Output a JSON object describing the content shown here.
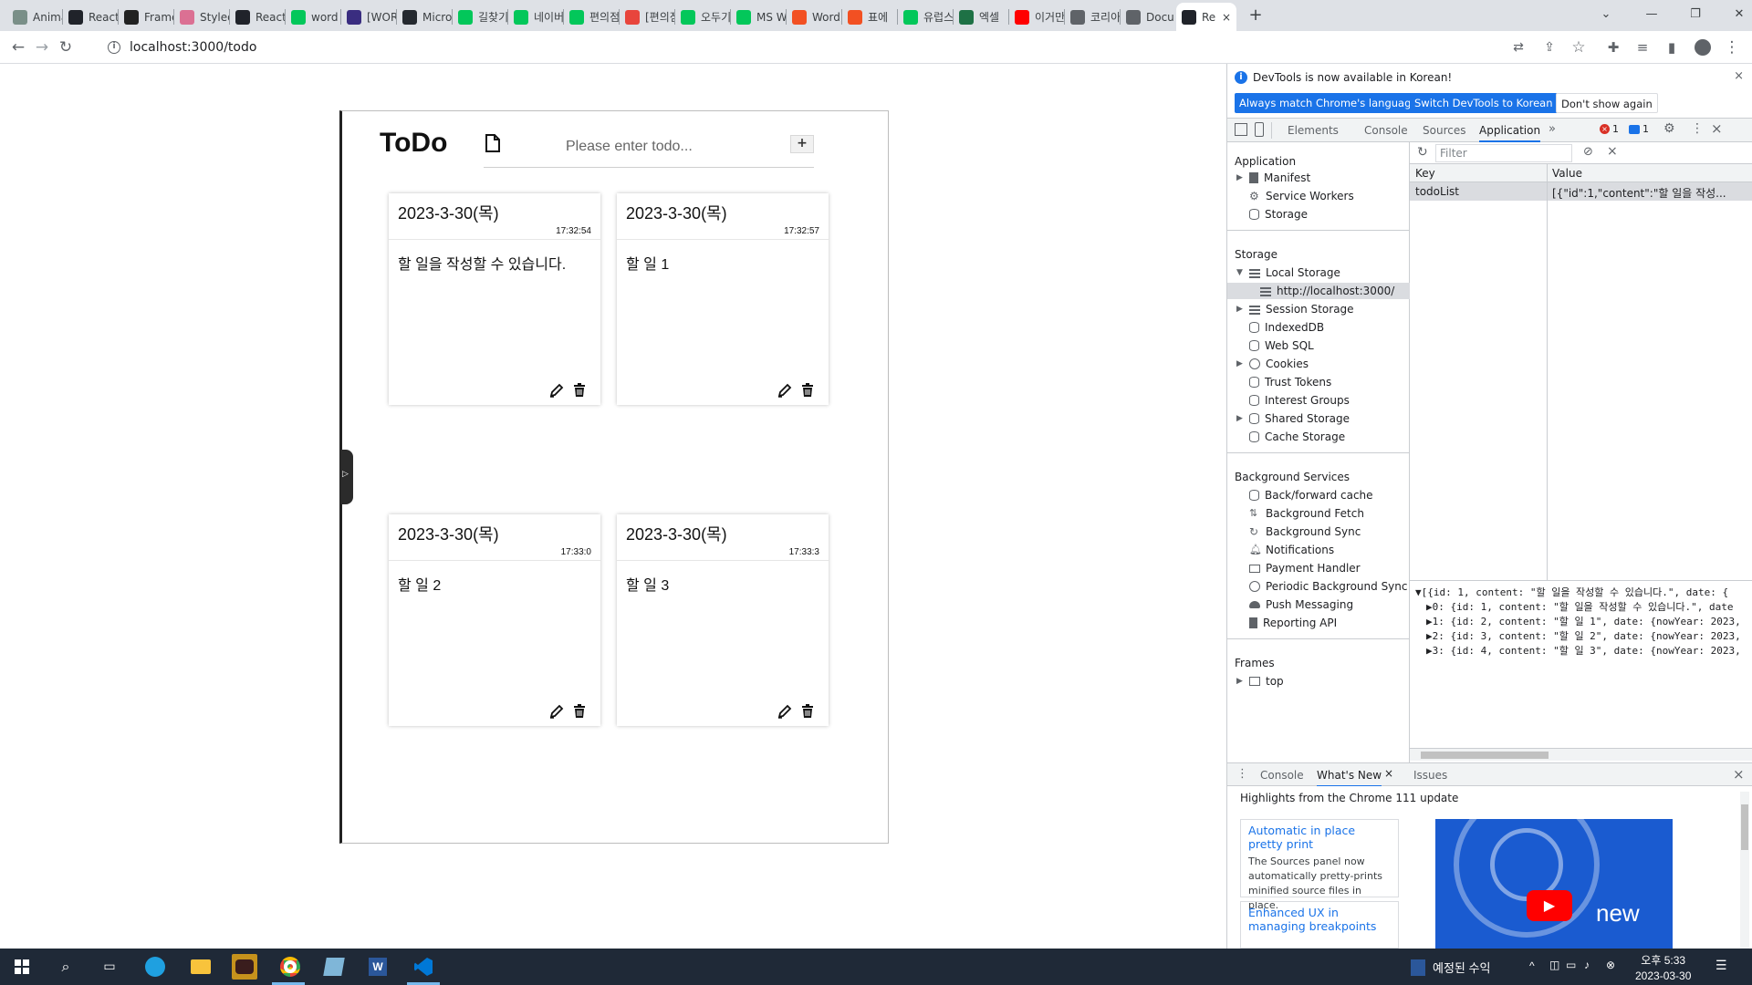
{
  "browser": {
    "tabs": [
      {
        "title": "Anima",
        "icon": "anima-favicon",
        "color": "#7a8f88"
      },
      {
        "title": "React",
        "icon": "react-favicon",
        "color": "#20232a"
      },
      {
        "title": "Frame",
        "icon": "framer-favicon",
        "color": "#222222"
      },
      {
        "title": "Styled",
        "icon": "styled-favicon",
        "color": "#db7093"
      },
      {
        "title": "React",
        "icon": "react-favicon",
        "color": "#20232a"
      },
      {
        "title": "word",
        "icon": "n-favicon",
        "color": "#03c75a"
      },
      {
        "title": "[WOR",
        "icon": "ag-favicon",
        "color": "#3a2d80"
      },
      {
        "title": "Micro",
        "icon": "github-favicon",
        "color": "#24292f"
      },
      {
        "title": "길찾기",
        "icon": "map-favicon",
        "color": "#03c75a"
      },
      {
        "title": "네이버",
        "icon": "map-favicon",
        "color": "#03c75a"
      },
      {
        "title": "편의점",
        "icon": "blog-favicon",
        "color": "#03c75a"
      },
      {
        "title": "[편의점",
        "icon": "t-favicon",
        "color": "#e8453c"
      },
      {
        "title": "오두기",
        "icon": "blog-favicon",
        "color": "#03c75a"
      },
      {
        "title": "MS W",
        "icon": "blog-favicon",
        "color": "#03c75a"
      },
      {
        "title": "Word",
        "icon": "ms-favicon",
        "color": "#f25022"
      },
      {
        "title": "표에 ",
        "icon": "ms-favicon",
        "color": "#f25022"
      },
      {
        "title": "유럽스",
        "icon": "blog-favicon",
        "color": "#03c75a"
      },
      {
        "title": "엑셀 ",
        "icon": "sheet-favicon",
        "color": "#1e7145"
      },
      {
        "title": "이거만",
        "icon": "youtube-favicon",
        "color": "#ff0000"
      },
      {
        "title": "코리아",
        "icon": "globe-favicon",
        "color": "#5f6368"
      },
      {
        "title": "Docu",
        "icon": "globe-favicon",
        "color": "#5f6368"
      },
      {
        "title": "Re",
        "icon": "react-favicon",
        "color": "#20232a",
        "active": true
      }
    ],
    "new_tab_label": "+",
    "url": "localhost:3000/todo"
  },
  "todo_app": {
    "title": "ToDo",
    "input_placeholder": "Please enter todo...",
    "add_button_label": "+",
    "cards": [
      {
        "date": "2023-3-30(목)",
        "time": "17:32:54",
        "content": "할 일을 작성할 수 있습니다."
      },
      {
        "date": "2023-3-30(목)",
        "time": "17:32:57",
        "content": "할 일 1"
      },
      {
        "date": "2023-3-30(목)",
        "time": "17:33:0",
        "content": "할 일 2"
      },
      {
        "date": "2023-3-30(목)",
        "time": "17:33:3",
        "content": "할 일 3"
      }
    ]
  },
  "devtools": {
    "info_message": "DevTools is now available in Korean!",
    "info_buttons": [
      "Always match Chrome's language",
      "Switch DevTools to Korean",
      "Don't show again"
    ],
    "panel_tabs": [
      "Elements",
      "Console",
      "Sources",
      "Application"
    ],
    "active_panel": "Application",
    "error_count": "1",
    "message_count": "1",
    "sidebar": {
      "application_header": "Application",
      "application_items": [
        "Manifest",
        "Service Workers",
        "Storage"
      ],
      "storage_header": "Storage",
      "storage_items": [
        "Local Storage",
        "http://localhost:3000/",
        "Session Storage",
        "IndexedDB",
        "Web SQL",
        "Cookies",
        "Trust Tokens",
        "Interest Groups",
        "Shared Storage",
        "Cache Storage"
      ],
      "background_header": "Background Services",
      "background_items": [
        "Back/forward cache",
        "Background Fetch",
        "Background Sync",
        "Notifications",
        "Payment Handler",
        "Periodic Background Sync",
        "Push Messaging",
        "Reporting API"
      ],
      "frames_header": "Frames",
      "frames_items": [
        "top"
      ]
    },
    "storage_table": {
      "filter_placeholder": "Filter",
      "columns": [
        "Key",
        "Value"
      ],
      "rows": [
        {
          "key": "todoList",
          "value": "[{\"id\":1,\"content\":\"할 일을 작성..."
        }
      ]
    },
    "preview_lines": [
      "▼[{id: 1, content: \"할 일을 작성할 수 있습니다.\", date: {",
      "▶0: {id: 1, content: \"할 일을 작성할 수 있습니다.\", date",
      "▶1: {id: 2, content: \"할 일 1\", date: {nowYear: 2023,",
      "▶2: {id: 3, content: \"할 일 2\", date: {nowYear: 2023,",
      "▶3: {id: 4, content: \"할 일 3\", date: {nowYear: 2023,"
    ],
    "drawer": {
      "tabs": [
        "Console",
        "What's New",
        "Issues"
      ],
      "active_tab": "What's New",
      "headline": "Highlights from the Chrome 111 update",
      "cards": [
        {
          "title": "Automatic in place pretty print",
          "desc": "The Sources panel now automatically pretty-prints minified source files in place."
        },
        {
          "title": "Enhanced UX in managing breakpoints",
          "desc": ""
        }
      ],
      "video_label": "new"
    }
  },
  "taskbar": {
    "weather_text": "예정된 수익",
    "time": "오후 5:33",
    "date": "2023-03-30"
  },
  "colors": {
    "accent": "#1a73e8",
    "tabstrip": "#dee1e6",
    "taskbar": "#1f2937"
  }
}
